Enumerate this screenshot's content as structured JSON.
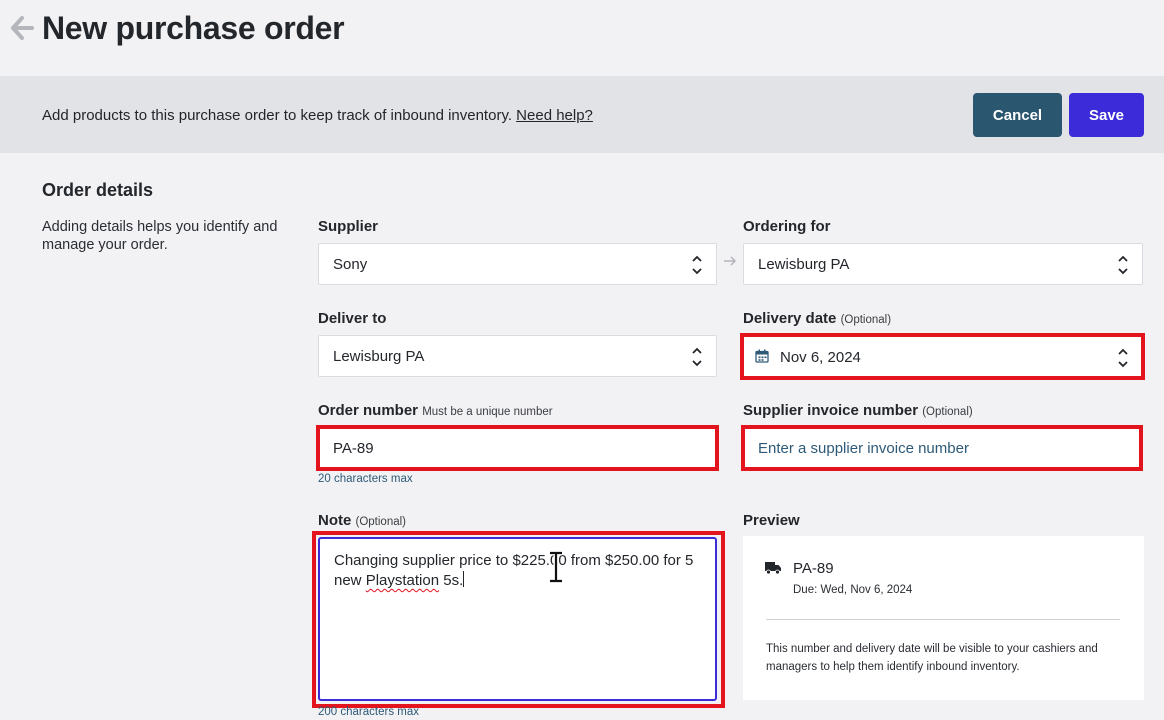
{
  "header": {
    "title": "New purchase order"
  },
  "banner": {
    "text": "Add products to this purchase order to keep track of inbound inventory. ",
    "help_link": "Need help?",
    "cancel_label": "Cancel",
    "save_label": "Save"
  },
  "section": {
    "title": "Order details",
    "description": "Adding details helps you identify and manage your order."
  },
  "form": {
    "supplier": {
      "label": "Supplier",
      "value": "Sony"
    },
    "ordering_for": {
      "label": "Ordering for",
      "value": "Lewisburg PA"
    },
    "deliver_to": {
      "label": "Deliver to",
      "value": "Lewisburg PA"
    },
    "delivery_date": {
      "label": "Delivery date",
      "optional": "(Optional)",
      "value": "Nov 6, 2024"
    },
    "order_number": {
      "label": "Order number",
      "hint_inline": "Must be a unique number",
      "value": "PA-89",
      "max_hint": "20 characters max"
    },
    "supplier_invoice": {
      "label": "Supplier invoice number",
      "optional": "(Optional)",
      "placeholder": "Enter a supplier invoice number"
    },
    "note": {
      "label": "Note",
      "optional": "(Optional)",
      "text_part1": "Changing supplier price to $225.00 from $250.00 for 5 new ",
      "text_misspelled": "Playstation",
      "text_part2": " 5s.",
      "max_hint": "200 characters max"
    }
  },
  "preview": {
    "label": "Preview",
    "order_number": "PA-89",
    "due": "Due: Wed, Nov 6, 2024",
    "info": "This number and delivery date will be visible to your cashiers and managers to help them identify inbound inventory."
  },
  "colors": {
    "highlight": "#e3141e",
    "save_button": "#3b2bd9",
    "cancel_button": "#2b5670",
    "link_blue": "#2e5a78"
  }
}
